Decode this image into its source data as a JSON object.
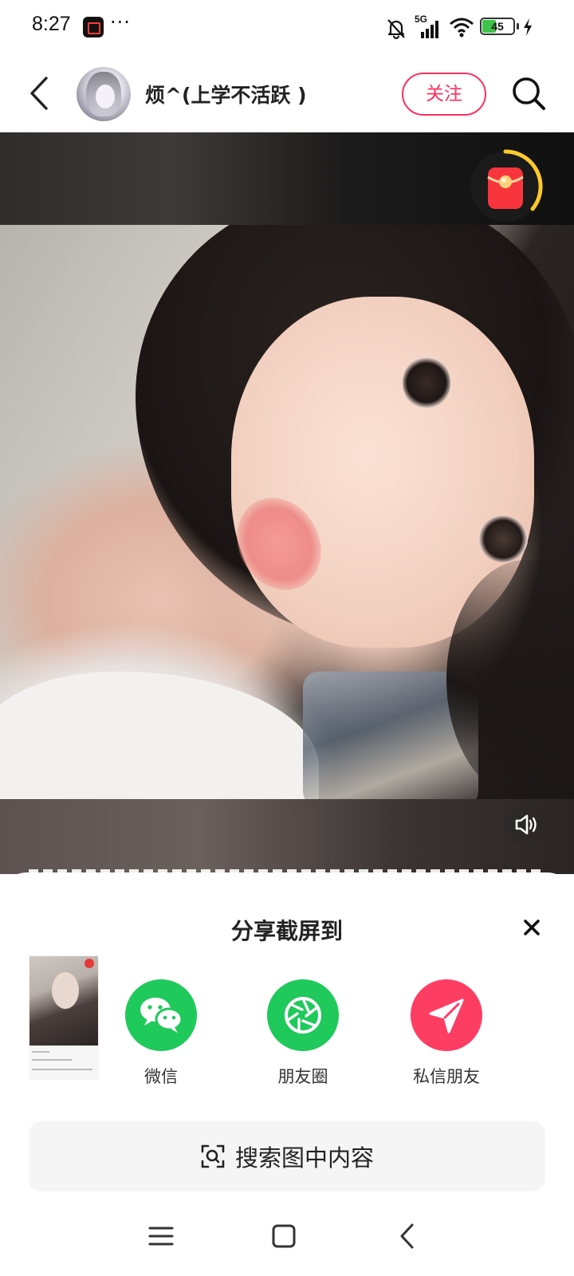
{
  "status_bar": {
    "time": "8:27",
    "dots": "···",
    "network": "5G",
    "battery_level": 45,
    "battery_text": "45"
  },
  "header": {
    "user_name": "烦^(上学不活跃 )",
    "follow_label": "关注"
  },
  "share_sheet": {
    "title": "分享截屏到",
    "options": [
      {
        "label": "微信",
        "icon": "wechat-icon",
        "color": "#1fc95b"
      },
      {
        "label": "朋友圈",
        "icon": "moments-icon",
        "color": "#1fc95b"
      },
      {
        "label": "私信朋友",
        "icon": "send-icon",
        "color": "#fe3d63"
      }
    ],
    "search_label": "搜索图中内容"
  },
  "colors": {
    "accent": "#ff2f5d",
    "wechat_green": "#1fc95b",
    "message_pink": "#fe3d63",
    "battery_green": "#3fc34a"
  }
}
